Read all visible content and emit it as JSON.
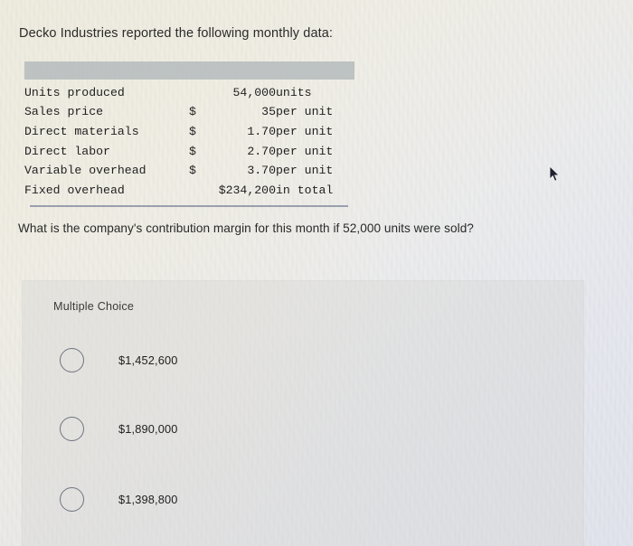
{
  "intro": "Decko Industries reported the following monthly data:",
  "data_table": {
    "rows": [
      {
        "label": "Units produced",
        "currency": "",
        "amount": "54,000",
        "unit": "units"
      },
      {
        "label": "Sales price",
        "currency": "$",
        "amount": "35",
        "unit": "per unit"
      },
      {
        "label": "Direct materials",
        "currency": "$",
        "amount": "1.70",
        "unit": "per unit"
      },
      {
        "label": "Direct labor",
        "currency": "$",
        "amount": "2.70",
        "unit": "per unit"
      },
      {
        "label": "Variable overhead",
        "currency": "$",
        "amount": "3.70",
        "unit": "per unit"
      },
      {
        "label": "Fixed overhead",
        "currency": "",
        "amount": "$234,200",
        "unit": "in total"
      }
    ]
  },
  "question": "What is the company's contribution margin for this month if 52,000 units were sold?",
  "multiple_choice": {
    "title": "Multiple Choice",
    "options": [
      {
        "value": "$1,452,600",
        "selected": false
      },
      {
        "value": "$1,890,000",
        "selected": false
      },
      {
        "value": "$1,398,800",
        "selected": false
      }
    ]
  },
  "colors": {
    "page_background": "#eeebe0",
    "table_header_bar": "#b6bcbd",
    "table_rule": "#8b93a3",
    "panel_background": "#d6d6d4",
    "radio_outline": "#6f7480",
    "text": "#1f1f1f"
  }
}
